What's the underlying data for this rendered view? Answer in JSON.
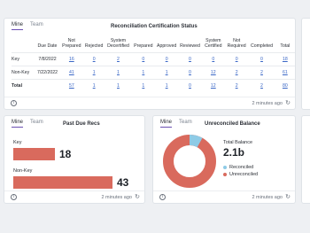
{
  "cert_card": {
    "tabs": [
      "Mine",
      "Team"
    ],
    "title": "Reconciliation Certification Status",
    "columns": [
      "",
      "Due Date",
      "Not Prepared",
      "Rejected",
      "System Decertified",
      "Prepared",
      "Approved",
      "Reviewed",
      "System Certified",
      "Not Required",
      "Completed",
      "Total"
    ],
    "rows": [
      [
        "Key",
        "7/8/2022",
        "16",
        "0",
        "2",
        "0",
        "0",
        "0",
        "0",
        "0",
        "0",
        "18"
      ],
      [
        "Non-Key",
        "7/22/2022",
        "41",
        "1",
        "1",
        "1",
        "1",
        "0",
        "12",
        "2",
        "2",
        "61"
      ],
      [
        "Total",
        "",
        "57",
        "1",
        "1",
        "1",
        "1",
        "0",
        "12",
        "2",
        "2",
        "80"
      ]
    ],
    "timestamp": "2 minutes ago"
  },
  "past_due_card": {
    "tabs": [
      "Mine",
      "Team"
    ],
    "title": "Past Due Recs",
    "bars": [
      {
        "label": "Key",
        "value": 18
      },
      {
        "label": "Non-Key",
        "value": 43
      }
    ],
    "timestamp": "2 minutes ago"
  },
  "unreconciled_card": {
    "tabs": [
      "Mine",
      "Team"
    ],
    "title": "Unreconciled Balance",
    "total_label": "Total Balance",
    "total_value": "2.1b",
    "legend": [
      {
        "label": "Reconciled",
        "color": "#8ecbe6",
        "fraction": 0.08
      },
      {
        "label": "Unreconciled",
        "color": "#d96a5d",
        "fraction": 0.92
      }
    ],
    "timestamp": "2 minutes ago"
  },
  "colors": {
    "accent": "#6b4fb3",
    "bar": "#d96a5d",
    "link": "#3a67c6"
  }
}
